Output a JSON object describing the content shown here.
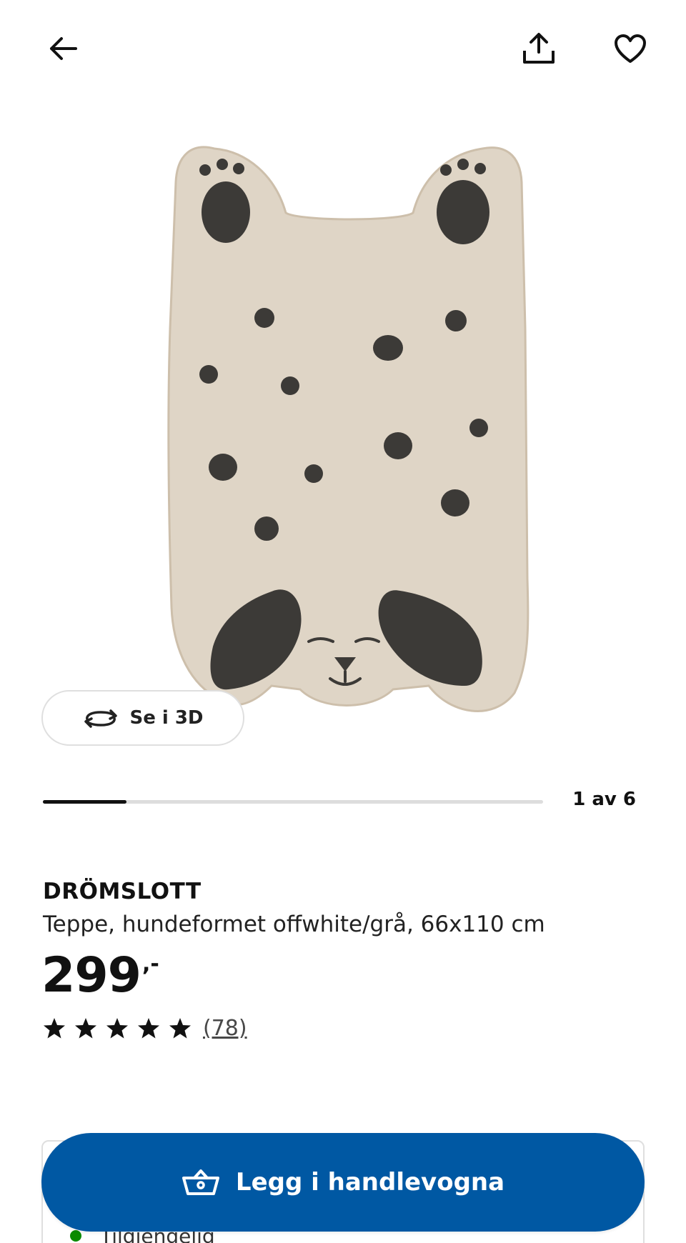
{
  "header": {
    "back_icon": "arrow-left-icon",
    "share_icon": "share-upload-icon",
    "favourite_icon": "heart-outline-icon"
  },
  "gallery": {
    "view_3d_label": "Se i 3D",
    "view_3d_icon": "rotate-3d-icon",
    "counter": "1 av 6",
    "progress_fraction": 0.1667
  },
  "product": {
    "brand": "DRÖMSLOTT",
    "description": "Teppe, hundeformet offwhite/grå, 66x110 cm",
    "price": "299",
    "price_suffix": ",-",
    "rating": {
      "stars_filled": 5,
      "stars_total": 5,
      "review_count": "(78)"
    }
  },
  "availability": {
    "text": "Tilgjengelig",
    "status_color": "#0a8a00"
  },
  "cart": {
    "label": "Legg i handlevogna",
    "icon": "basket-icon",
    "color": "#0058a3"
  },
  "colors": {
    "rug_base": "#dfd5c6",
    "rug_spots": "#3c3a37"
  }
}
